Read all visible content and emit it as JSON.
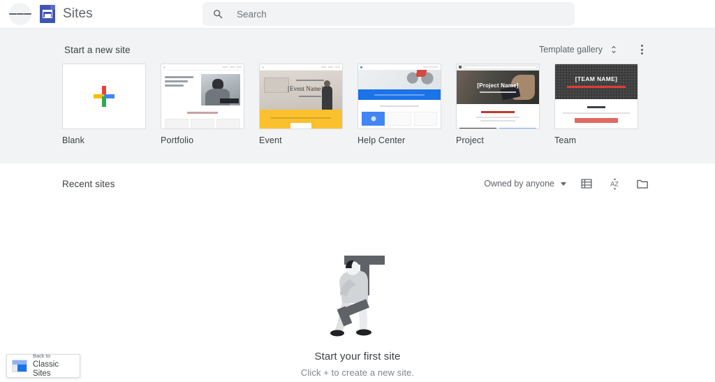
{
  "topbar": {
    "menu_icon": "hamburger-menu-icon",
    "logo_icon": "google-sites-logo-icon",
    "app_title": "Sites",
    "search": {
      "icon": "search-icon",
      "placeholder": "Search",
      "value": ""
    }
  },
  "templates": {
    "heading": "Start a new site",
    "gallery_toggle_label": "Template gallery",
    "gallery_toggle_icon": "unfold-more-icon",
    "overflow_icon": "more-vert-icon",
    "items": [
      {
        "label": "Blank",
        "thumb": "blank-plus-thumbnail"
      },
      {
        "label": "Portfolio",
        "thumb": "portfolio-thumbnail"
      },
      {
        "label": "Event",
        "thumb": "event-thumbnail"
      },
      {
        "label": "Help Center",
        "thumb": "help-center-thumbnail"
      },
      {
        "label": "Project",
        "thumb": "project-thumbnail"
      },
      {
        "label": "Team",
        "thumb": "team-thumbnail"
      }
    ],
    "blank_card": {
      "plus_colors": {
        "top": "#ea4335",
        "left": "#fbbc04",
        "right": "#4285f4",
        "bottom": "#34a853"
      }
    },
    "event_card": {
      "title": "[Event Name]",
      "accent": "#fbc02d"
    },
    "project_card": {
      "title": "[Project Name]"
    },
    "team_card": {
      "title": "[TEAM NAME]",
      "accent": "#e53935"
    }
  },
  "recent": {
    "heading": "Recent sites",
    "owner_filter_label": "Owned by anyone",
    "owner_filter_caret_icon": "caret-down-icon",
    "list_view_icon": "list-view-icon",
    "sort_icon": "sort-az-icon",
    "folder_icon": "folder-icon"
  },
  "empty_state": {
    "illustration": "person-carrying-letter-t-illustration",
    "title": "Start your first site",
    "subtitle": "Click + to create a new site."
  },
  "classic_chip": {
    "icon": "classic-sites-icon",
    "line1": "Back to",
    "line2": "Classic Sites"
  },
  "colors": {
    "brand_blue": "#4055b3",
    "accent_blue": "#1a73e8",
    "section_bg": "#f1f3f4",
    "text_primary": "#3c4043",
    "text_secondary": "#5f6368"
  }
}
